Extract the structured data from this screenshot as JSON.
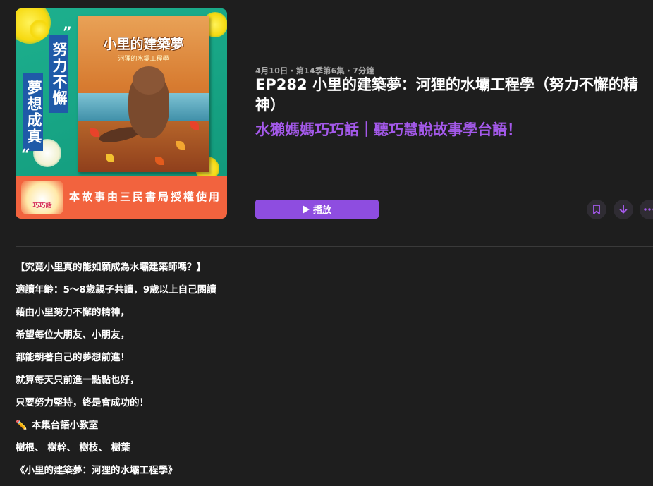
{
  "artwork": {
    "book_title": "小里的建築夢",
    "book_subtitle": "河狸的水壩工程學",
    "quote_open": "”",
    "quote_close": "“",
    "vertical_text_1": "努力不懈",
    "vertical_text_2": "夢想成真",
    "banner_text": "本故事由三民書局授權使用",
    "logo_text": "巧巧話"
  },
  "episode": {
    "meta": "4月10日・第14季第6集・7分鐘",
    "title": "EP282 小里的建築夢：河狸的水壩工程學（努力不懈的精神）",
    "show_name": "水獺媽媽巧巧話｜聽巧慧說故事學台語！"
  },
  "actions": {
    "play_label": "播放",
    "bookmark_icon": "bookmark-icon",
    "download_icon": "download-icon",
    "more_icon": "more-icon",
    "accent_color": "#8e4de0"
  },
  "description": [
    "【究竟小里真的能如願成為水壩建築師嗎？】",
    "適讀年齡：5～8歲親子共讀，9歲以上自己閱讀",
    "藉由小里努力不懈的精神，",
    "希望每位大朋友、小朋友，",
    "都能朝著自己的夢想前進！",
    "就算每天只前進一點點也好，",
    "只要努力堅持，終是會成功的！",
    "本集台語小教室",
    "樹根、 樹幹、 樹枝、 樹葉",
    "《小里的建築夢：河狸的水壩工程學》"
  ],
  "description_emoji": "✏️"
}
